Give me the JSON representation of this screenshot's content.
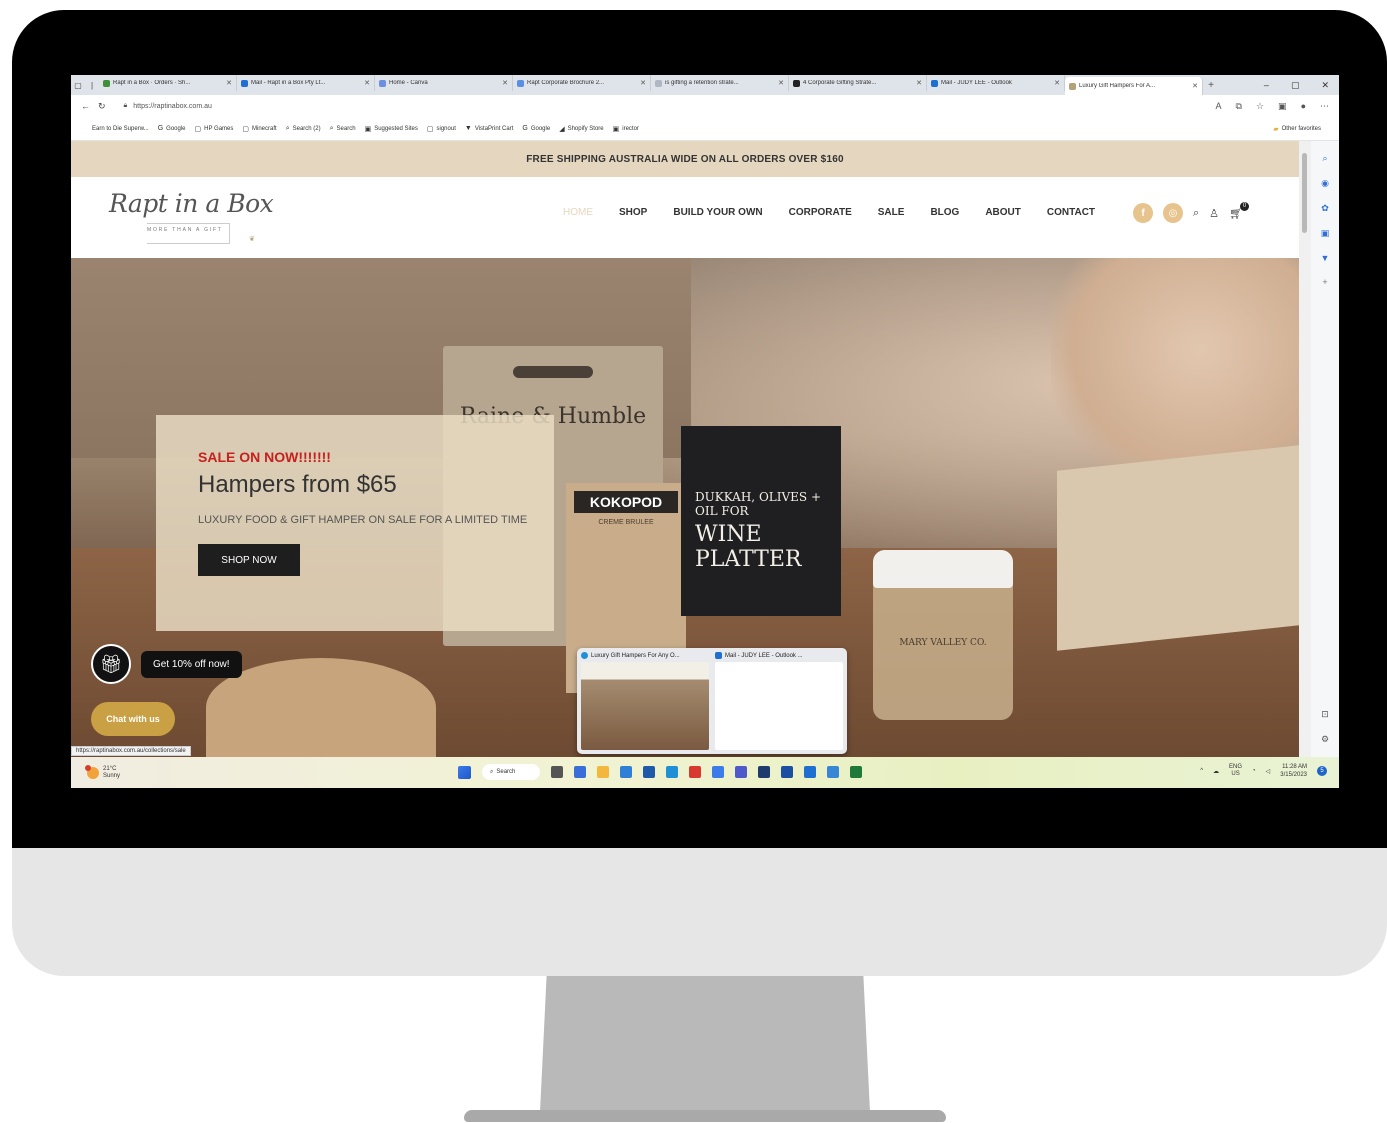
{
  "browser": {
    "tabs": [
      {
        "label": "Rapt in a Box · Orders · Sh...",
        "color": "#3f8f3a"
      },
      {
        "label": "Mail - Rapt in a Box Pty Lt...",
        "color": "#1f6fd0"
      },
      {
        "label": "Home - Canva",
        "color": "#6c8fe0"
      },
      {
        "label": "Rapt Corporate Brochure 2...",
        "color": "#5a8fe6"
      },
      {
        "label": "is gifting a retention strate...",
        "color": "#b0b6c4"
      },
      {
        "label": "4 Corporate Gifting Strate...",
        "color": "#222222"
      },
      {
        "label": "Mail - JUDY LEE - Outlook",
        "color": "#1f6fd0"
      },
      {
        "label": "Luxury Gift Hampers For A...",
        "color": "#b4a178"
      }
    ],
    "url": "https://raptinabox.com.au",
    "bookmarks": [
      {
        "icon": "",
        "label": "Earn to Die Superw..."
      },
      {
        "icon": "G",
        "label": "Google"
      },
      {
        "icon": "▢",
        "label": "HP Games"
      },
      {
        "icon": "▢",
        "label": "Minecraft"
      },
      {
        "icon": "⌕",
        "label": "Search (2)"
      },
      {
        "icon": "⌕",
        "label": "Search"
      },
      {
        "icon": "▣",
        "label": "Suggested Sites"
      },
      {
        "icon": "▢",
        "label": "signout"
      },
      {
        "icon": "▼",
        "label": "VistaPrint Cart"
      },
      {
        "icon": "G",
        "label": "Google"
      },
      {
        "icon": "◢",
        "label": "Shopify Store"
      },
      {
        "icon": "▣",
        "label": "irector"
      }
    ],
    "other_favorites": "Other favorites",
    "status_url": "https://raptinabox.com.au/collections/sale"
  },
  "site": {
    "promo_bar": "FREE SHIPPING AUSTRALIA WIDE ON ALL ORDERS OVER $160",
    "logo_script": "Rapt in a Box",
    "logo_tagline": "MORE THAN A GIFT",
    "nav": [
      "HOME",
      "SHOP",
      "BUILD YOUR OWN",
      "CORPORATE",
      "SALE",
      "BLOG",
      "ABOUT",
      "CONTACT"
    ],
    "cart_count": "0",
    "hero": {
      "sale_label": "SALE ON NOW!!!!!!!",
      "title": "Hampers from $65",
      "description": "LUXURY FOOD & GIFT HAMPER ON SALE FOR A LIMITED TIME",
      "button": "SHOP NOW"
    },
    "promo_popup": "Get 10% off now!",
    "chat_button": "Chat with us",
    "product_labels": {
      "raine": "Raine & Humble",
      "kokopod": "KOKOPOD",
      "creme": "CREME BRULEE",
      "dukkah": "DUKKAH, OLIVES + OIL FOR",
      "wine_platter": "WINE PLATTER",
      "mary_valley": "MARY VALLEY CO."
    }
  },
  "thumbnails": [
    {
      "title": "Luxury Gift Hampers For Any O...",
      "color": "#b4a178"
    },
    {
      "title": "Mail - JUDY LEE - Outlook ...",
      "color": "#1f6fd0"
    }
  ],
  "taskbar": {
    "weather_temp": "21°C",
    "weather_desc": "Sunny",
    "search": "Search",
    "apps": [
      "#555555",
      "#3b6fd8",
      "#f3b73e",
      "#2f7fd6",
      "#1f5aa8",
      "#1f8fd6",
      "#d93a2f",
      "#3c7bea",
      "#5059c9",
      "#1f3a6d",
      "#1d4fa0",
      "#1f6fd0",
      "#3a86d6",
      "#1f7a3a"
    ],
    "lang": "ENG",
    "region": "US",
    "time": "11:28 AM",
    "date": "3/15/2023",
    "notif": "5"
  }
}
